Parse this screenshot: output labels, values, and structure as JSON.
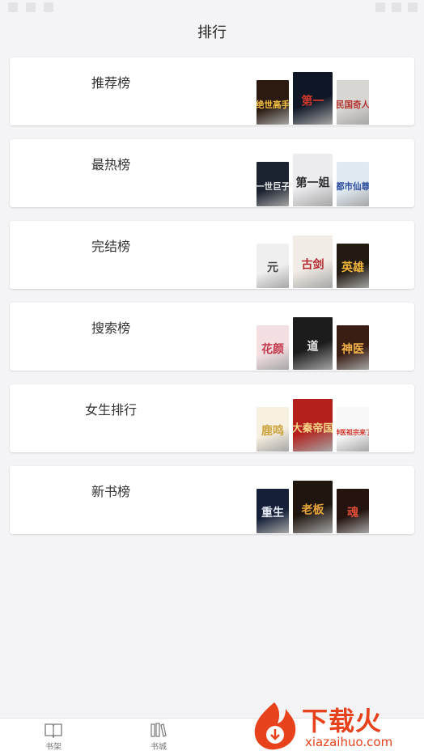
{
  "header": {
    "title": "排行"
  },
  "rankings": [
    {
      "label": "推荐榜",
      "covers": [
        {
          "text": "绝世高手",
          "bg": "#2a1a10",
          "fg": "#f6c343"
        },
        {
          "text": "第一",
          "bg": "#0f1626",
          "fg": "#d33a2c"
        },
        {
          "text": "民国奇人",
          "bg": "#d8d6d2",
          "fg": "#b5332e"
        }
      ]
    },
    {
      "label": "最热榜",
      "covers": [
        {
          "text": "一世巨子",
          "bg": "#1b2230",
          "fg": "#e9e9ea"
        },
        {
          "text": "第一姐",
          "bg": "#ecebee",
          "fg": "#2b2b2f"
        },
        {
          "text": "都市仙尊",
          "bg": "#dfe9f2",
          "fg": "#2e4f9e"
        }
      ]
    },
    {
      "label": "完结榜",
      "covers": [
        {
          "text": "元",
          "bg": "#efefef",
          "fg": "#444"
        },
        {
          "text": "古剑",
          "bg": "#f2ece6",
          "fg": "#b3262a"
        },
        {
          "text": "英雄",
          "bg": "#231b12",
          "fg": "#f0b73b"
        }
      ]
    },
    {
      "label": "搜索榜",
      "covers": [
        {
          "text": "花颜",
          "bg": "#f3dfe2",
          "fg": "#c5374a"
        },
        {
          "text": "道",
          "bg": "#1c1c1c",
          "fg": "#e8e8e8"
        },
        {
          "text": "神医",
          "bg": "#3a1e14",
          "fg": "#f3b24a"
        }
      ]
    },
    {
      "label": "女生排行",
      "covers": [
        {
          "text": "鹿鸣",
          "bg": "#f7efe0",
          "fg": "#caa23a"
        },
        {
          "text": "大秦帝国",
          "bg": "#b4201c",
          "fg": "#f6d78a"
        },
        {
          "text": "神医祖宗来了",
          "bg": "#f8f8f8",
          "fg": "#d2382e"
        }
      ]
    },
    {
      "label": "新书榜",
      "covers": [
        {
          "text": "重生",
          "bg": "#152038",
          "fg": "#e3e8f2"
        },
        {
          "text": "老板",
          "bg": "#201610",
          "fg": "#e8a53c"
        },
        {
          "text": "魂",
          "bg": "#24130f",
          "fg": "#e24d38"
        }
      ]
    }
  ],
  "tabbar": {
    "bookshelf": "书架",
    "bookstore": "书城"
  },
  "watermark": {
    "text": "下载火",
    "url": "xiazaihuo.com",
    "color": "#e8421c"
  }
}
